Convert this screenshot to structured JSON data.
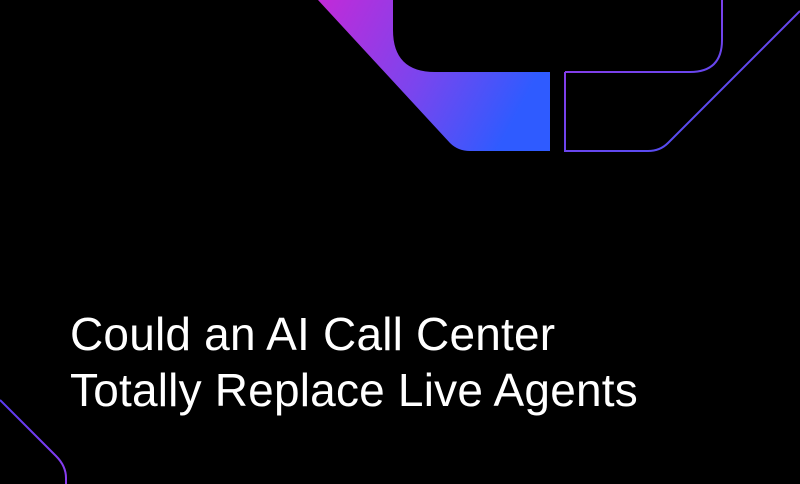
{
  "headline": {
    "line1": "Could an AI Call Center",
    "line2": "Totally Replace Live Agents"
  },
  "colors": {
    "background": "#000000",
    "text": "#ffffff",
    "gradient_start": "#c22ad8",
    "gradient_mid": "#7a45ee",
    "gradient_end": "#2f5bff",
    "outline_purple": "#8b3df0",
    "outline_blue": "#3b55f5"
  },
  "decorations": [
    "gradient-chevron-shape",
    "outline-chevron-shape",
    "corner-outline-shape"
  ]
}
